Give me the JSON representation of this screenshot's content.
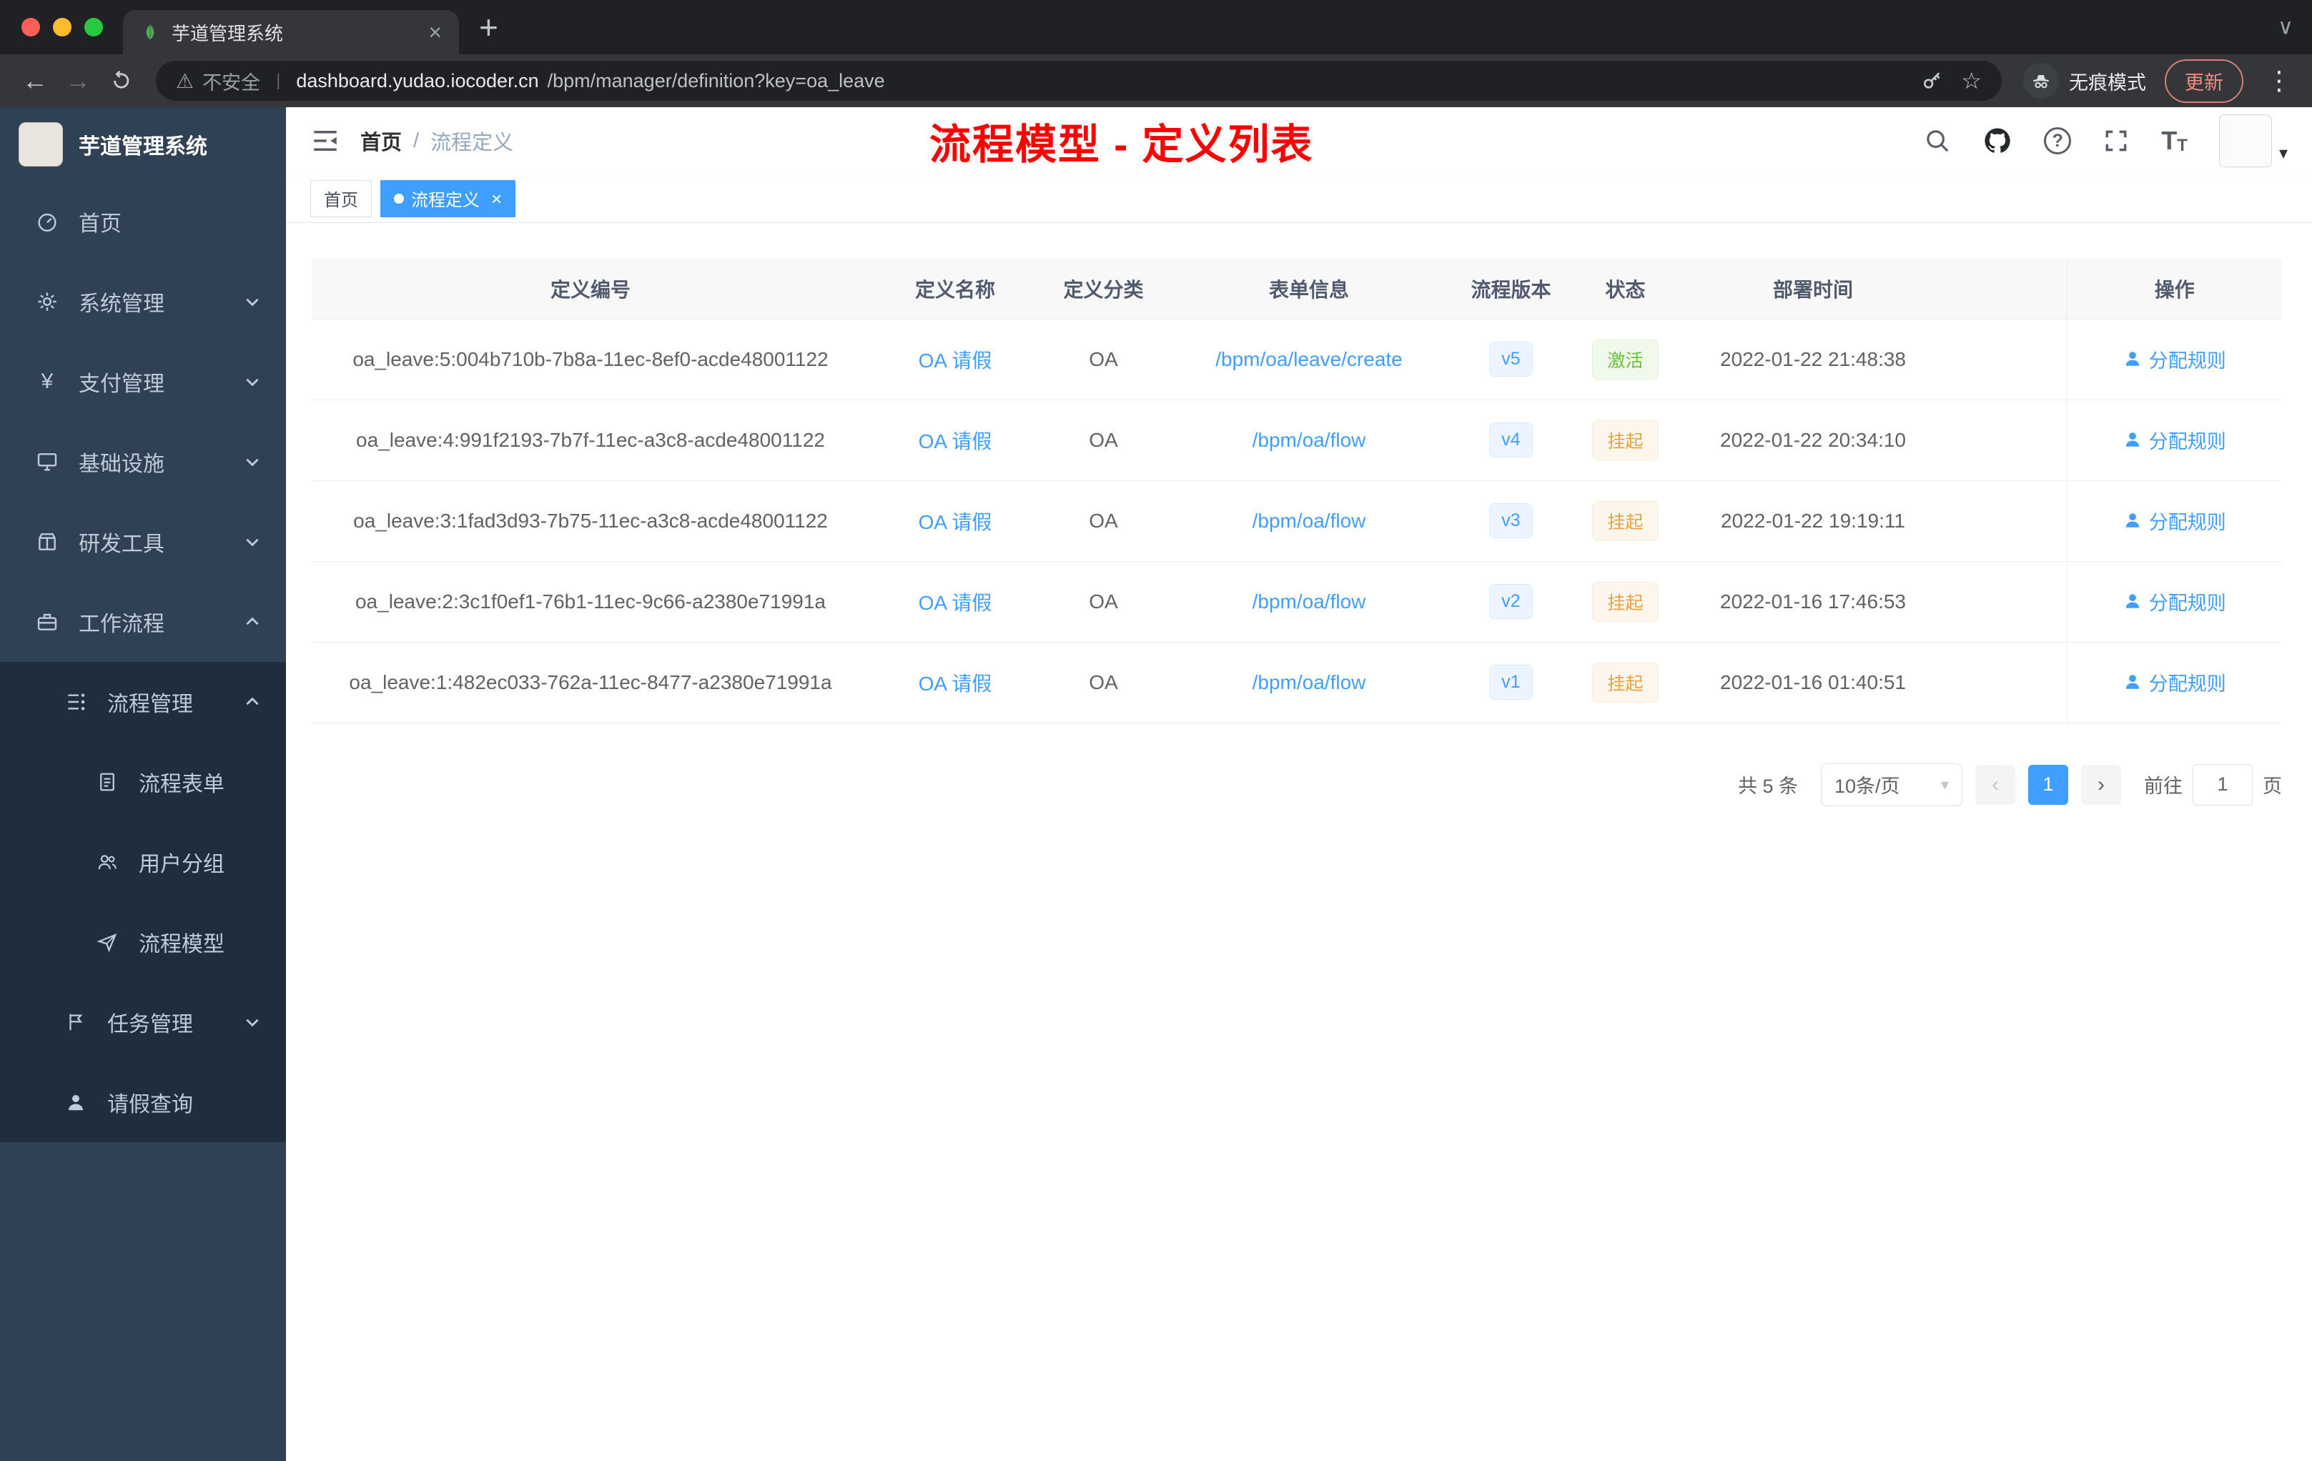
{
  "browser": {
    "tab_title": "芋道管理系统",
    "not_secure": "不安全",
    "url_host": "dashboard.yudao.iocoder.cn",
    "url_path": "/bpm/manager/definition?key=oa_leave",
    "incognito": "无痕模式",
    "update": "更新"
  },
  "icons": {
    "close": "×",
    "plus": "+",
    "back": "←",
    "forward": "→",
    "warning": "⚠",
    "star": "☆",
    "kebab": "⋮",
    "window_chevron": "∨",
    "caret_down": "▾",
    "divider": "|",
    "prev": "‹",
    "next": "›",
    "t_big": "T",
    "t_small": "T"
  },
  "sidebar": {
    "logo_title": "芋道管理系统",
    "items": [
      {
        "label": "首页"
      },
      {
        "label": "系统管理"
      },
      {
        "label": "支付管理"
      },
      {
        "label": "基础设施"
      },
      {
        "label": "研发工具"
      },
      {
        "label": "工作流程"
      },
      {
        "label": "流程管理"
      },
      {
        "label": "流程表单"
      },
      {
        "label": "用户分组"
      },
      {
        "label": "流程模型"
      },
      {
        "label": "任务管理"
      },
      {
        "label": "请假查询"
      }
    ]
  },
  "navbar": {
    "breadcrumb_home": "首页",
    "breadcrumb_sep": "/",
    "breadcrumb_current": "流程定义",
    "annotation": "流程模型 - 定义列表",
    "annotation_color": "#ff0000"
  },
  "tags": {
    "home": "首页",
    "active": "流程定义"
  },
  "table": {
    "columns": [
      "定义编号",
      "定义名称",
      "定义分类",
      "表单信息",
      "流程版本",
      "状态",
      "部署时间",
      "操作"
    ],
    "action_label": "分配规则",
    "rows": [
      {
        "id": "oa_leave:5:004b710b-7b8a-11ec-8ef0-acde48001122",
        "name": "OA 请假",
        "category": "OA",
        "form": "/bpm/oa/leave/create",
        "version": "v5",
        "status": "激活",
        "time": "2022-01-22 21:48:38"
      },
      {
        "id": "oa_leave:4:991f2193-7b7f-11ec-a3c8-acde48001122",
        "name": "OA 请假",
        "category": "OA",
        "form": "/bpm/oa/flow",
        "version": "v4",
        "status": "挂起",
        "time": "2022-01-22 20:34:10"
      },
      {
        "id": "oa_leave:3:1fad3d93-7b75-11ec-a3c8-acde48001122",
        "name": "OA 请假",
        "category": "OA",
        "form": "/bpm/oa/flow",
        "version": "v3",
        "status": "挂起",
        "time": "2022-01-22 19:19:11"
      },
      {
        "id": "oa_leave:2:3c1f0ef1-76b1-11ec-9c66-a2380e71991a",
        "name": "OA 请假",
        "category": "OA",
        "form": "/bpm/oa/flow",
        "version": "v2",
        "status": "挂起",
        "time": "2022-01-16 17:46:53"
      },
      {
        "id": "oa_leave:1:482ec033-762a-11ec-8477-a2380e71991a",
        "name": "OA 请假",
        "category": "OA",
        "form": "/bpm/oa/flow",
        "version": "v1",
        "status": "挂起",
        "time": "2022-01-16 01:40:51"
      }
    ]
  },
  "pagination": {
    "total": "共 5 条",
    "page_size": "10条/页",
    "page": "1",
    "goto": "前往",
    "goto_value": "1",
    "unit": "页"
  },
  "colors": {
    "accent": "#409eff",
    "success": "#67c23a",
    "warning": "#e6a23c"
  }
}
